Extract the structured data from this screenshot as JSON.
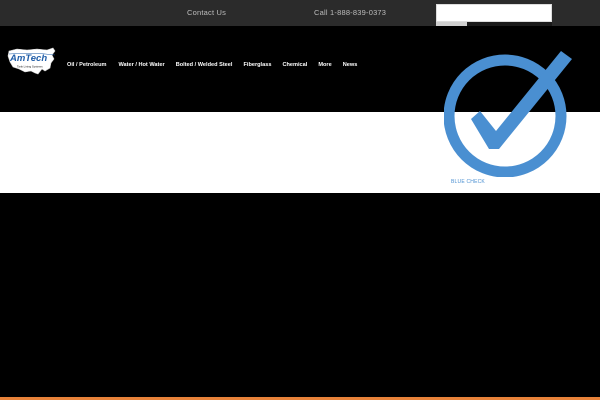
{
  "topbar": {
    "contact_label": "Contact Us",
    "phone_label": "Call 1-888-839-0373",
    "search": {
      "value": "",
      "placeholder": ""
    }
  },
  "logo": {
    "name": "AmTech",
    "tagline": "Tank Lining Systems",
    "icon": "usa-map-icon"
  },
  "nav": {
    "items": [
      {
        "label": "Oil / Petroleum"
      },
      {
        "label": "Water / Hot Water"
      },
      {
        "label": "Bolted / Welded Steel"
      },
      {
        "label": "Fiberglass"
      },
      {
        "label": "Chemical"
      },
      {
        "label": "More"
      },
      {
        "label": "News"
      }
    ]
  },
  "badge": {
    "icon": "blue-checkmark-icon",
    "caption": "BLUE CHECK"
  },
  "colors": {
    "topbar_bg": "#2b2b2b",
    "nav_bg": "#000000",
    "band_bg": "#ffffff",
    "check_blue": "#4a8fd1",
    "accent_orange": "#e8833a"
  }
}
